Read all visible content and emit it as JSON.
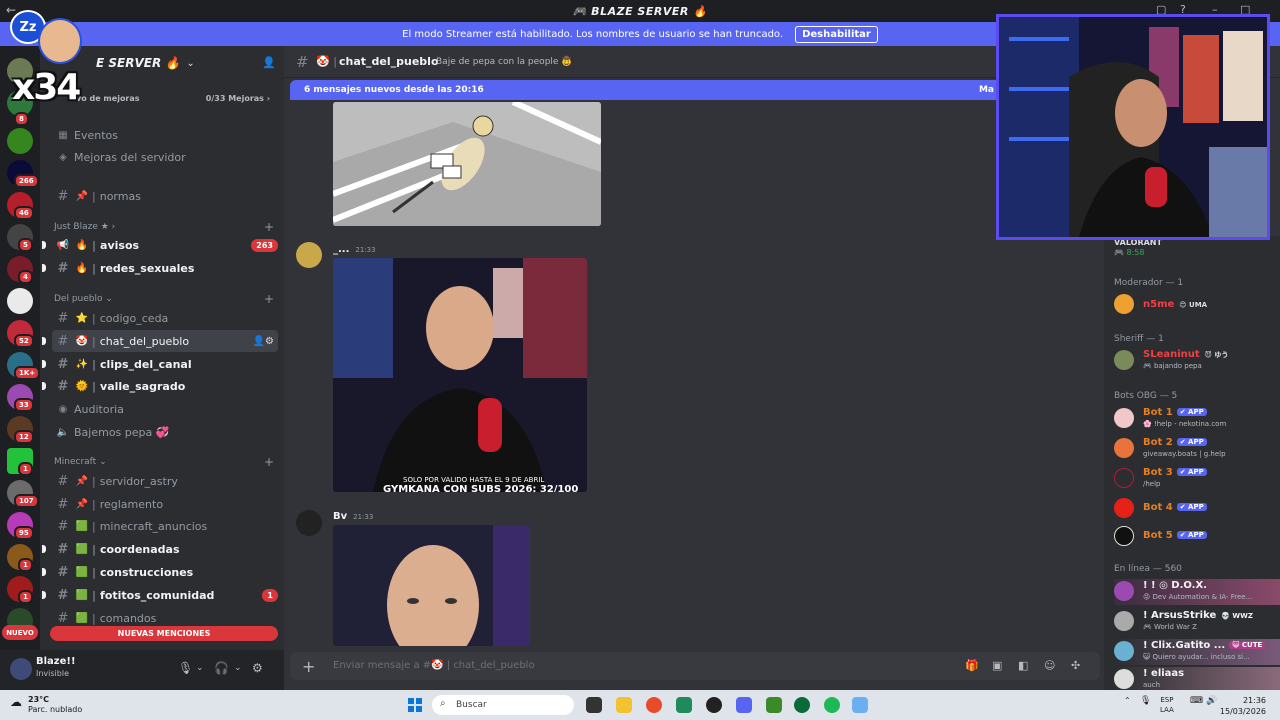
{
  "titlebar": {
    "title": "🎮 BLAZE SERVER 🔥"
  },
  "banner": {
    "text": "El modo Streamer está habilitado. Los nombres de usuario se han truncado.",
    "button": "Deshabilitar"
  },
  "rail": {
    "badges": [
      "8",
      "266",
      "46",
      "5",
      "4",
      "52",
      "1K+",
      "33",
      "12",
      "1",
      "107",
      "95",
      "1",
      "1"
    ],
    "new_pill": "NUEVO"
  },
  "server": {
    "name": "E SERVER 🔥",
    "boost_label": "vo de mejoras",
    "boost_count": "0/33 Mejoras ›"
  },
  "sidebar": {
    "events": "Eventos",
    "server_boosts": "Mejoras del servidor",
    "normas": "normas",
    "cat_just_blaze": "Just Blaze ★ ›",
    "avisos": "avisos",
    "avisos_count": "263",
    "redes": "redes_sexuales",
    "cat_del_pueblo": "Del pueblo ⌄",
    "codigo": "codigo_ceda",
    "chat": "chat_del_pueblo",
    "clips": "clips_del_canal",
    "valle": "valle_sagrado",
    "auditoria": "Auditoria",
    "bajemos": "Bajemos pepa 💞",
    "cat_minecraft": "Minecraft ⌄",
    "servidor_astry": "servidor_astry",
    "reglamento": "reglamento",
    "mc_anuncios": "minecraft_anuncios",
    "coordenadas": "coordenadas",
    "construcciones": "construcciones",
    "fotitos": "fotitos_comunidad",
    "fotitos_count": "1",
    "comandos": "comandos",
    "new_mentions": "NUEVAS MENCIONES"
  },
  "user": {
    "name": "Blaze!!",
    "status": "Invisible"
  },
  "chat": {
    "channel": "chat_del_pueblo",
    "topic": "Baje de pepa con la people 🤠",
    "new_messages": "6 mensajes nuevos desde las 20:16",
    "new_messages_right": "Ma",
    "messages": [
      {
        "author": "_...",
        "time": "21:33"
      },
      {
        "author": "Bv",
        "time": "21:33"
      }
    ],
    "image_caption_1": "SOLO POR VALIDO HASTA EL 9 DE ABRIL",
    "image_caption_2": "GYMKANA CON SUBS 2026: 32/100",
    "input_placeholder": "Enviar mensaje a #🤡 | chat_del_pueblo"
  },
  "members": {
    "top_activity_name": "VALORANT",
    "top_activity_time": "🎮 8:58",
    "moderator_header": "Moderador — 1",
    "sheriff_header": "Sheriff — 1",
    "bots_header": "Bots OBG — 5",
    "online_header": "En línea — 560",
    "moderator": [
      {
        "name": "n5me",
        "tag": "😊 UMA",
        "color": "#f23f43"
      }
    ],
    "sheriff": [
      {
        "name": "SLeaninut",
        "tag": "😈 ゆう",
        "activity": "🎮 bajando pepa",
        "color": "#f23f43"
      }
    ],
    "bots": [
      {
        "name": "Bot 1",
        "tag": "✔ APP",
        "activity": "🌸 !help - nekotina.com"
      },
      {
        "name": "Bot 2",
        "tag": "✔ APP",
        "activity": "giveaway.boats | g.help"
      },
      {
        "name": "Bot 3",
        "tag": "✔ APP",
        "activity": "/help"
      },
      {
        "name": "Bot 4",
        "tag": "✔ APP",
        "activity": ""
      },
      {
        "name": "Bot 5",
        "tag": "✔ APP",
        "activity": ""
      }
    ],
    "online": [
      {
        "name": "! ! ◎ D.O.X.",
        "tag": "",
        "activity": "😡 Dev Automation & IA- Free..."
      },
      {
        "name": "! ArsusStrike",
        "tag": "💀 WWZ",
        "activity": "🎮 World War Z"
      },
      {
        "name": "! Clix.Gatito ...",
        "tag": "😺 CUTE",
        "activity": "😺 Quiero ayudar... incluso si..."
      },
      {
        "name": "! eliaas",
        "tag": "",
        "activity": "auch"
      }
    ]
  },
  "overlay": {
    "zz": "Zz",
    "multiplier": "x34"
  },
  "taskbar": {
    "temp": "23°C",
    "weather": "Parc. nublado",
    "search": "Buscar",
    "lang1": "ESP",
    "lang2": "LAA",
    "time": "21:36",
    "date": "15/03/2026"
  }
}
